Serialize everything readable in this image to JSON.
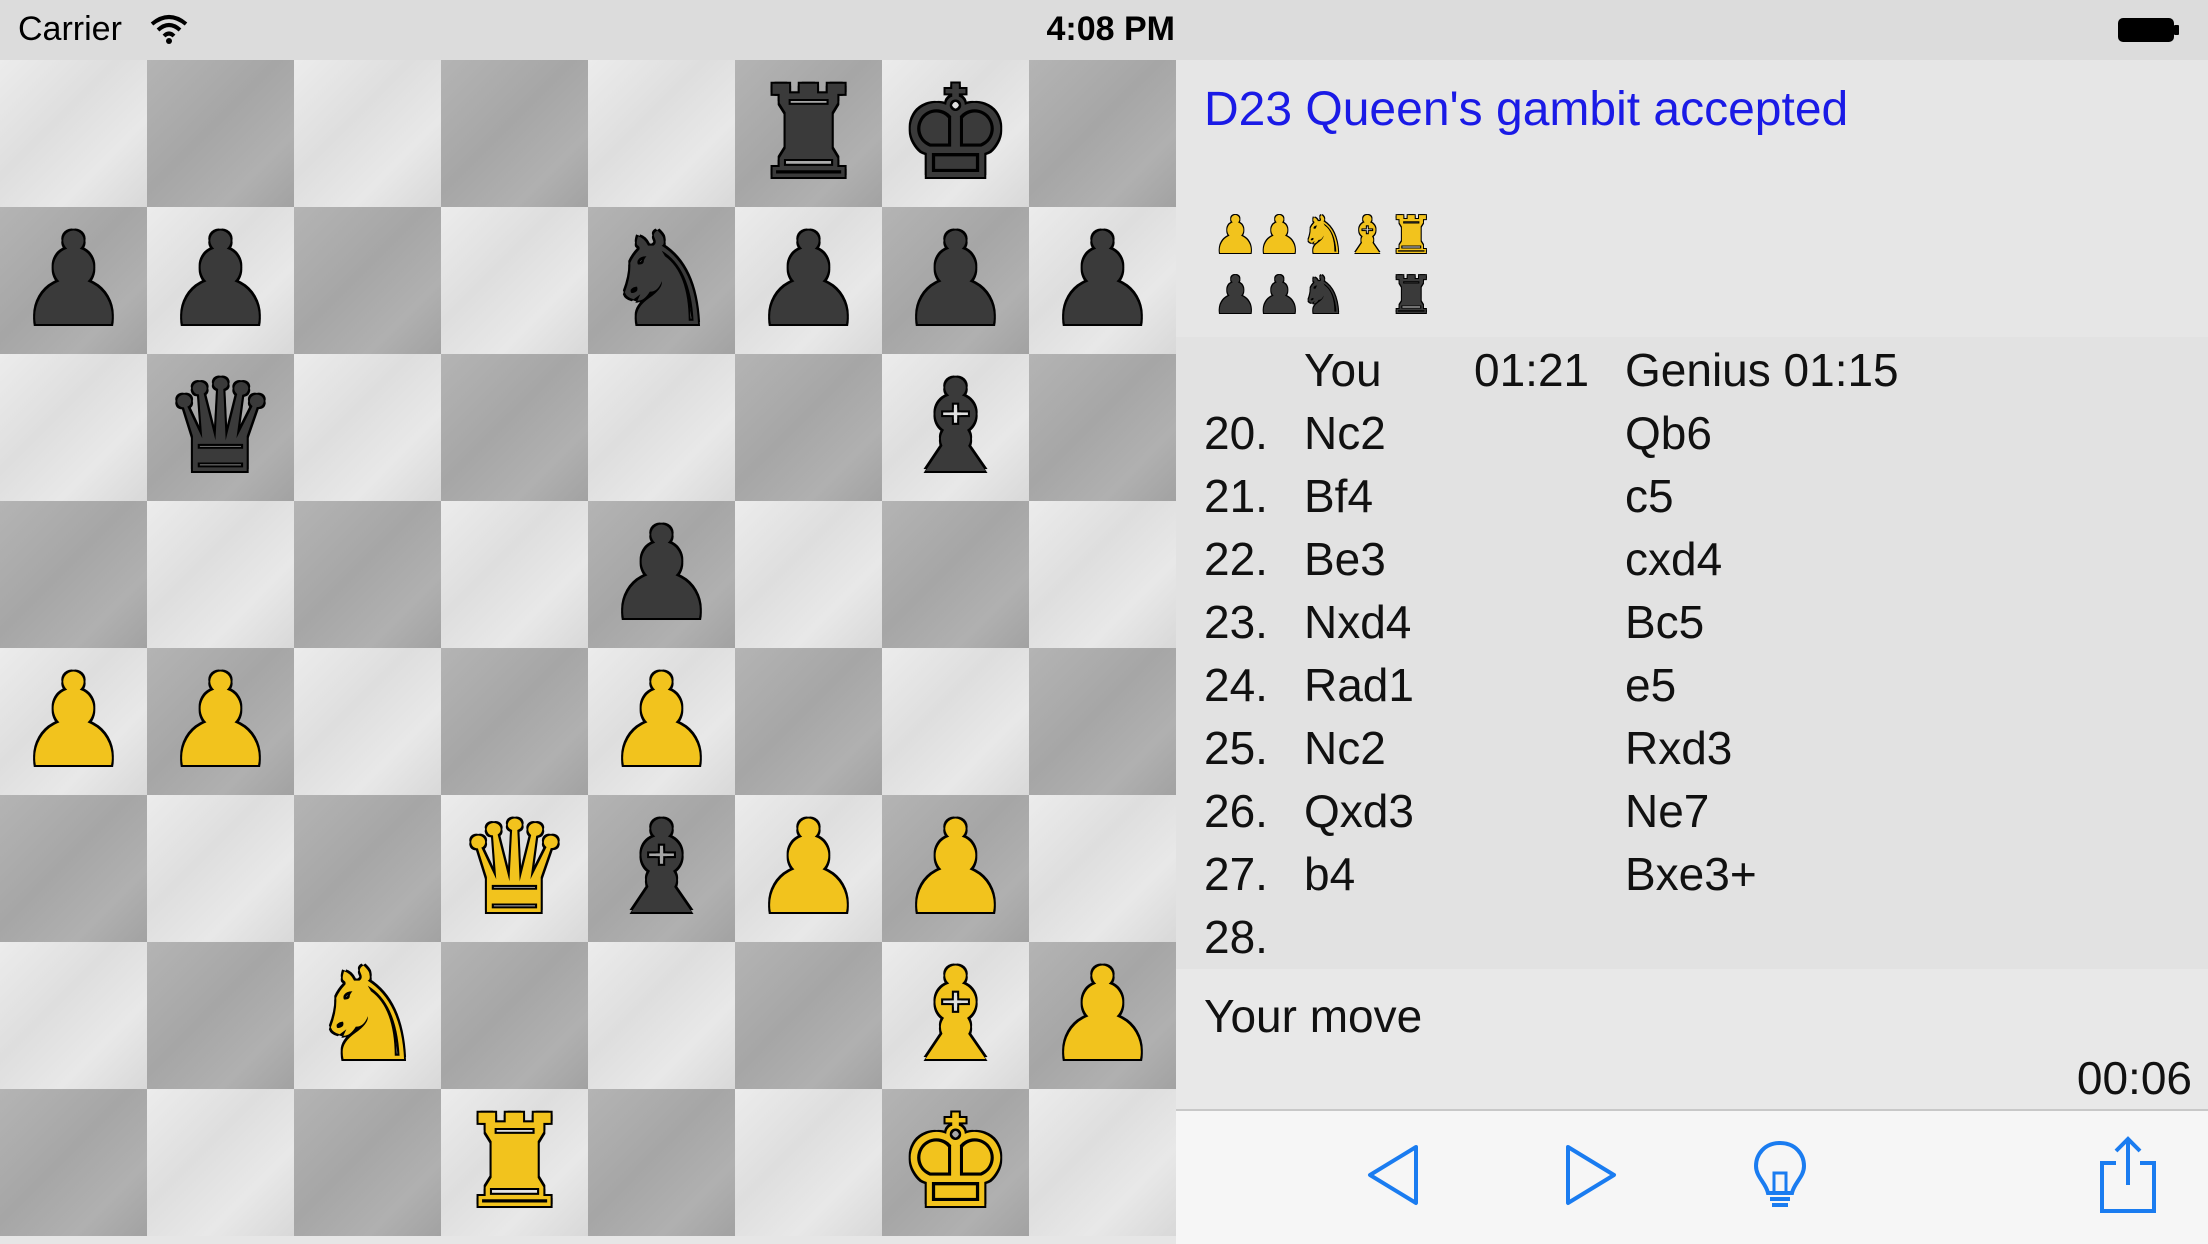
{
  "status_bar": {
    "carrier": "Carrier",
    "time": "4:08 PM"
  },
  "board": {
    "pieces": [
      {
        "file": 5,
        "rank": 0,
        "glyph": "♜",
        "color": "b",
        "name": "black-rook-icon"
      },
      {
        "file": 6,
        "rank": 0,
        "glyph": "♚",
        "color": "b",
        "name": "black-king-icon"
      },
      {
        "file": 0,
        "rank": 1,
        "glyph": "♟",
        "color": "b",
        "name": "black-pawn-icon"
      },
      {
        "file": 1,
        "rank": 1,
        "glyph": "♟",
        "color": "b",
        "name": "black-pawn-icon"
      },
      {
        "file": 4,
        "rank": 1,
        "glyph": "♞",
        "color": "b",
        "name": "black-knight-icon"
      },
      {
        "file": 5,
        "rank": 1,
        "glyph": "♟",
        "color": "b",
        "name": "black-pawn-icon"
      },
      {
        "file": 6,
        "rank": 1,
        "glyph": "♟",
        "color": "b",
        "name": "black-pawn-icon"
      },
      {
        "file": 7,
        "rank": 1,
        "glyph": "♟",
        "color": "b",
        "name": "black-pawn-icon"
      },
      {
        "file": 1,
        "rank": 2,
        "glyph": "♛",
        "color": "b",
        "name": "black-queen-icon"
      },
      {
        "file": 6,
        "rank": 2,
        "glyph": "♝",
        "color": "b",
        "name": "black-bishop-icon"
      },
      {
        "file": 4,
        "rank": 3,
        "glyph": "♟",
        "color": "b",
        "name": "black-pawn-icon"
      },
      {
        "file": 0,
        "rank": 4,
        "glyph": "♟",
        "color": "w",
        "name": "white-pawn-icon"
      },
      {
        "file": 1,
        "rank": 4,
        "glyph": "♟",
        "color": "w",
        "name": "white-pawn-icon"
      },
      {
        "file": 4,
        "rank": 4,
        "glyph": "♟",
        "color": "w",
        "name": "white-pawn-icon"
      },
      {
        "file": 3,
        "rank": 5,
        "glyph": "♛",
        "color": "w",
        "name": "white-queen-icon"
      },
      {
        "file": 4,
        "rank": 5,
        "glyph": "♝",
        "color": "b",
        "name": "black-bishop-icon"
      },
      {
        "file": 5,
        "rank": 5,
        "glyph": "♟",
        "color": "w",
        "name": "white-pawn-icon"
      },
      {
        "file": 6,
        "rank": 5,
        "glyph": "♟",
        "color": "w",
        "name": "white-pawn-icon"
      },
      {
        "file": 2,
        "rank": 6,
        "glyph": "♞",
        "color": "w",
        "name": "white-knight-icon"
      },
      {
        "file": 6,
        "rank": 6,
        "glyph": "♝",
        "color": "w",
        "name": "white-bishop-icon"
      },
      {
        "file": 7,
        "rank": 6,
        "glyph": "♟",
        "color": "w",
        "name": "white-pawn-icon"
      },
      {
        "file": 3,
        "rank": 7,
        "glyph": "♜",
        "color": "w",
        "name": "white-rook-icon"
      },
      {
        "file": 6,
        "rank": 7,
        "glyph": "♚",
        "color": "w",
        "name": "white-king-icon"
      }
    ]
  },
  "panel": {
    "opening": "D23 Queen's gambit accepted",
    "captured_white": [
      "♟",
      "♟",
      "♞",
      "♝",
      "♜"
    ],
    "captured_black": [
      "♟",
      "♟",
      "♞",
      "",
      "♜"
    ],
    "header": {
      "player": "You",
      "player_time": "01:21",
      "opponent": "Genius 01:15"
    },
    "moves": [
      {
        "num": "20.",
        "white": "Nc2",
        "black": "Qb6"
      },
      {
        "num": "21.",
        "white": "Bf4",
        "black": "c5"
      },
      {
        "num": "22.",
        "white": "Be3",
        "black": "cxd4"
      },
      {
        "num": "23.",
        "white": "Nxd4",
        "black": "Bc5"
      },
      {
        "num": "24.",
        "white": "Rad1",
        "black": "e5"
      },
      {
        "num": "25.",
        "white": "Nc2",
        "black": "Rxd3"
      },
      {
        "num": "26.",
        "white": "Qxd3",
        "black": "Ne7"
      },
      {
        "num": "27.",
        "white": "b4",
        "black": "Bxe3+"
      },
      {
        "num": "28.",
        "white": "",
        "black": ""
      }
    ],
    "status": "Your move",
    "move_timer": "00:06"
  },
  "toolbar": {
    "buttons": [
      "back-arrow-icon",
      "forward-arrow-icon",
      "hint-lightbulb-icon",
      "share-icon"
    ],
    "accent_color": "#1a7cf0"
  }
}
